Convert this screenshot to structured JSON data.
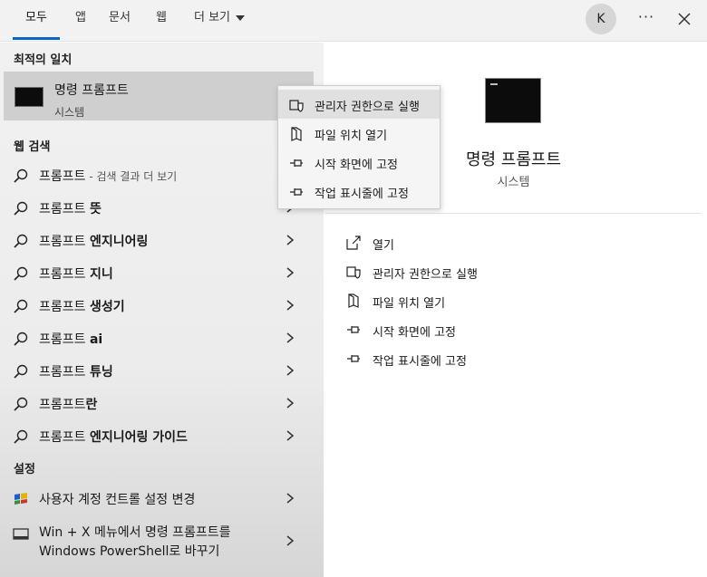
{
  "tabs": [
    {
      "label": "모두"
    },
    {
      "label": "앱"
    },
    {
      "label": "문서"
    },
    {
      "label": "웹"
    },
    {
      "label": "더 보기"
    }
  ],
  "account": {
    "initial": "K"
  },
  "more_label": "···",
  "best_match": {
    "heading": "최적의 일치",
    "name": "명령 프롬프트",
    "type": "시스템"
  },
  "web": {
    "heading": "웹 검색",
    "first": {
      "query": "프롬프트",
      "hint": " - 검색 결과 더 보기"
    },
    "items": [
      {
        "prefix": "프롬프트 ",
        "bold": "뜻"
      },
      {
        "prefix": "프롬프트 ",
        "bold": "엔지니어링"
      },
      {
        "prefix": "프롬프트 ",
        "bold": "지니"
      },
      {
        "prefix": "프롬프트 ",
        "bold": "생성기"
      },
      {
        "prefix": "프롬프트 ",
        "bold": "ai"
      },
      {
        "prefix": "프롬프트 ",
        "bold": "튜닝"
      },
      {
        "prefix": "프롬프트",
        "bold": "란"
      },
      {
        "prefix": "프롬프트 ",
        "bold": "엔지니어링 가이드"
      }
    ]
  },
  "settings": {
    "heading": "설정",
    "uac": "사용자 계정 컨트롤 설정 변경",
    "powershell_line1": "Win + X 메뉴에서 명령 프롬프트를",
    "powershell_line2": "Windows PowerShell로 바꾸기"
  },
  "context_menu": [
    {
      "label": "관리자 권한으로 실행",
      "icon": "shield-icon"
    },
    {
      "label": "파일 위치 열기",
      "icon": "folder-icon"
    },
    {
      "label": "시작 화면에 고정",
      "icon": "pin-icon"
    },
    {
      "label": "작업 표시줄에 고정",
      "icon": "pin-icon"
    }
  ],
  "detail": {
    "name": "명령 프롬프트",
    "type": "시스템",
    "actions": [
      {
        "label": "열기",
        "icon": "open-icon"
      },
      {
        "label": "관리자 권한으로 실행",
        "icon": "shield-icon"
      },
      {
        "label": "파일 위치 열기",
        "icon": "folder-icon"
      },
      {
        "label": "시작 화면에 고정",
        "icon": "pin-icon"
      },
      {
        "label": "작업 표시줄에 고정",
        "icon": "pin-icon"
      }
    ]
  },
  "colors": {
    "accent": "#0a64c8",
    "selected_row": "#cfcfcf",
    "panel_bg": "#f1f1f1"
  }
}
